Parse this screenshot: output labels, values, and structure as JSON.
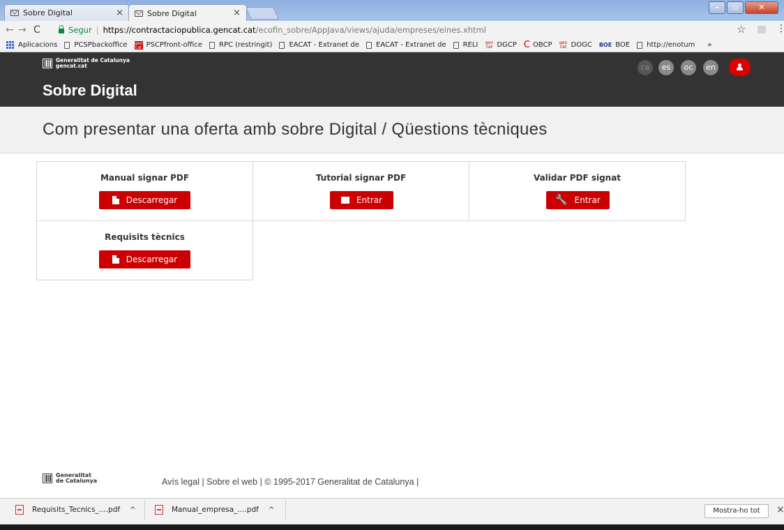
{
  "browser": {
    "tabs": [
      {
        "title": "Sobre Digital",
        "close": "×"
      },
      {
        "title": "Sobre Digital",
        "close": "×"
      }
    ],
    "address": {
      "secure_label": "Segur",
      "url_host": "https://contractaciopublica.gencat.cat",
      "url_path": "/ecofin_sobre/AppJava/views/ajuda/empreses/eines.xhtml"
    },
    "bookmarks": [
      {
        "label": "Aplicacions",
        "icon": "apps-icon"
      },
      {
        "label": "PCSPbackoffice",
        "icon": "page-icon"
      },
      {
        "label": "PSCPfront-office",
        "icon": "gencat-icon"
      },
      {
        "label": "RPC (restringit)",
        "icon": "page-icon"
      },
      {
        "label": "EACAT - Extranet de",
        "icon": "page-icon"
      },
      {
        "label": "EACAT - Extranet de",
        "icon": "page-icon"
      },
      {
        "label": "RELI",
        "icon": "page-icon"
      },
      {
        "label": "DGCP",
        "icon": "gencat-icon"
      },
      {
        "label": "OBCP",
        "icon": "c-icon"
      },
      {
        "label": "DOGC",
        "icon": "gencat-icon"
      },
      {
        "label": "BOE",
        "icon": "boe-icon"
      },
      {
        "label": "http://enotum",
        "icon": "page-icon"
      }
    ],
    "more": "»"
  },
  "header": {
    "logo_line1": "Generalitat de Catalunya",
    "logo_line2": "gencat.cat",
    "site_title": "Sobre Digital",
    "languages": [
      "ca",
      "es",
      "oc",
      "en"
    ]
  },
  "main": {
    "page_title": "Com presentar una oferta amb sobre Digital / Qüestions tècniques",
    "cards": [
      {
        "title": "Manual signar PDF",
        "button": "Descarregar",
        "icon": "document-icon"
      },
      {
        "title": "Tutorial signar PDF",
        "button": "Entrar",
        "icon": "square-icon"
      },
      {
        "title": "Validar PDF signat",
        "button": "Entrar",
        "icon": "wrench-icon"
      },
      {
        "title": "Requisits tècnics",
        "button": "Descarregar",
        "icon": "document-icon"
      }
    ]
  },
  "footer": {
    "logo_line1": "Generalitat",
    "logo_line2": "de Catalunya",
    "links": "Avís legal | Sobre el web | © 1995-2017 Generalitat de Catalunya |"
  },
  "downloads": {
    "items": [
      {
        "name": "Requisits_Tecnics_....pdf"
      },
      {
        "name": "Manual_empresa_....pdf"
      }
    ],
    "show_all": "Mostra-ho tot",
    "close": "×"
  },
  "colors": {
    "header_bg": "#333333",
    "accent_red": "#cc0000",
    "subheader_bg": "#f1f1f1"
  }
}
